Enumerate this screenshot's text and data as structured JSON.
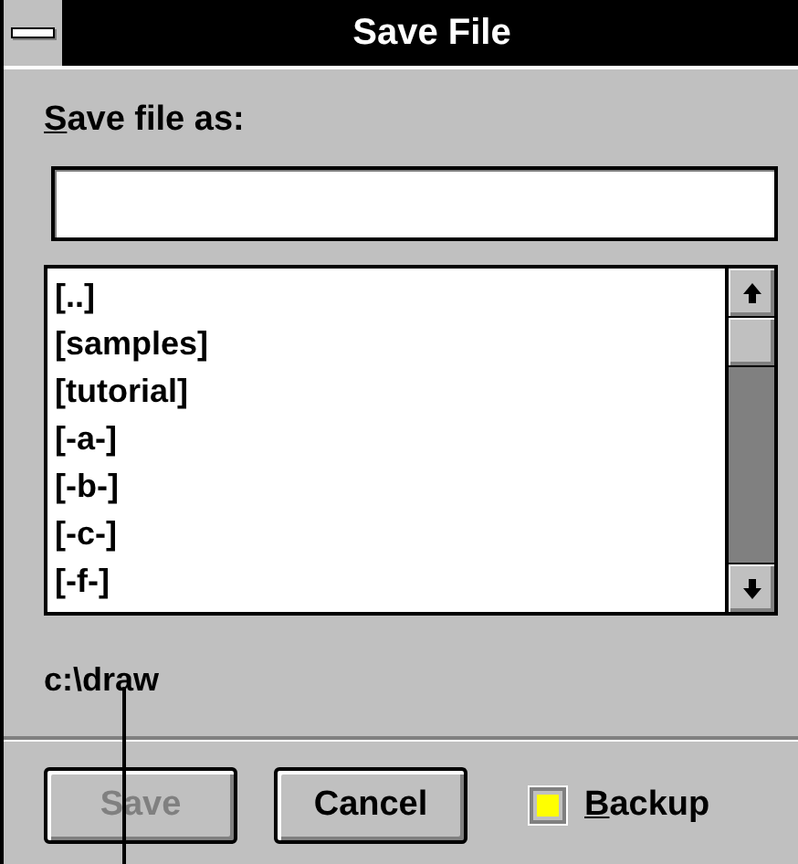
{
  "window": {
    "title": "Save File"
  },
  "filename": {
    "label_mnemonic": "S",
    "label_rest": "ave file as:"
  },
  "directories": [
    {
      "name": "[..]"
    },
    {
      "name": "[samples]"
    },
    {
      "name": "[tutorial]"
    },
    {
      "name": "[-a-]"
    },
    {
      "name": "[-b-]"
    },
    {
      "name": "[-c-]"
    },
    {
      "name": "[-f-]"
    }
  ],
  "current_path": "c:\\draw",
  "buttons": [
    {
      "label": "Save",
      "disabled": true
    },
    {
      "label": "Cancel",
      "disabled": false
    }
  ],
  "backup": {
    "mnemonic": "B",
    "rest": "ackup",
    "checked": true
  }
}
